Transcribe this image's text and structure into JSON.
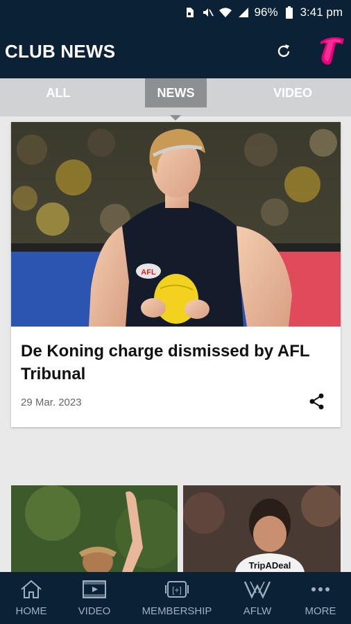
{
  "status_bar": {
    "battery": "96%",
    "time": "3:41 pm"
  },
  "header": {
    "title": "CLUB NEWS"
  },
  "tabs": [
    {
      "label": "ALL"
    },
    {
      "label": "NEWS",
      "active": true
    },
    {
      "label": "VIDEO"
    }
  ],
  "featured": {
    "headline": "De Koning charge dismissed by AFL Tribunal",
    "date": "29 Mar. 2023",
    "jersey_text": "AFL"
  },
  "thumb_right": {
    "jersey_text": "TripADeal"
  },
  "bottom_nav": [
    {
      "label": "HOME",
      "icon": "home-icon"
    },
    {
      "label": "VIDEO",
      "icon": "video-icon"
    },
    {
      "label": "MEMBERSHIP",
      "icon": "membership-icon"
    },
    {
      "label": "AFLW",
      "icon": "aflw-icon"
    },
    {
      "label": "MORE",
      "icon": "more-icon"
    }
  ],
  "colors": {
    "navy": "#0b2236",
    "brand_pink": "#e6007e",
    "tab_active": "#8d9093",
    "tab_bar": "#d0d2d4"
  }
}
